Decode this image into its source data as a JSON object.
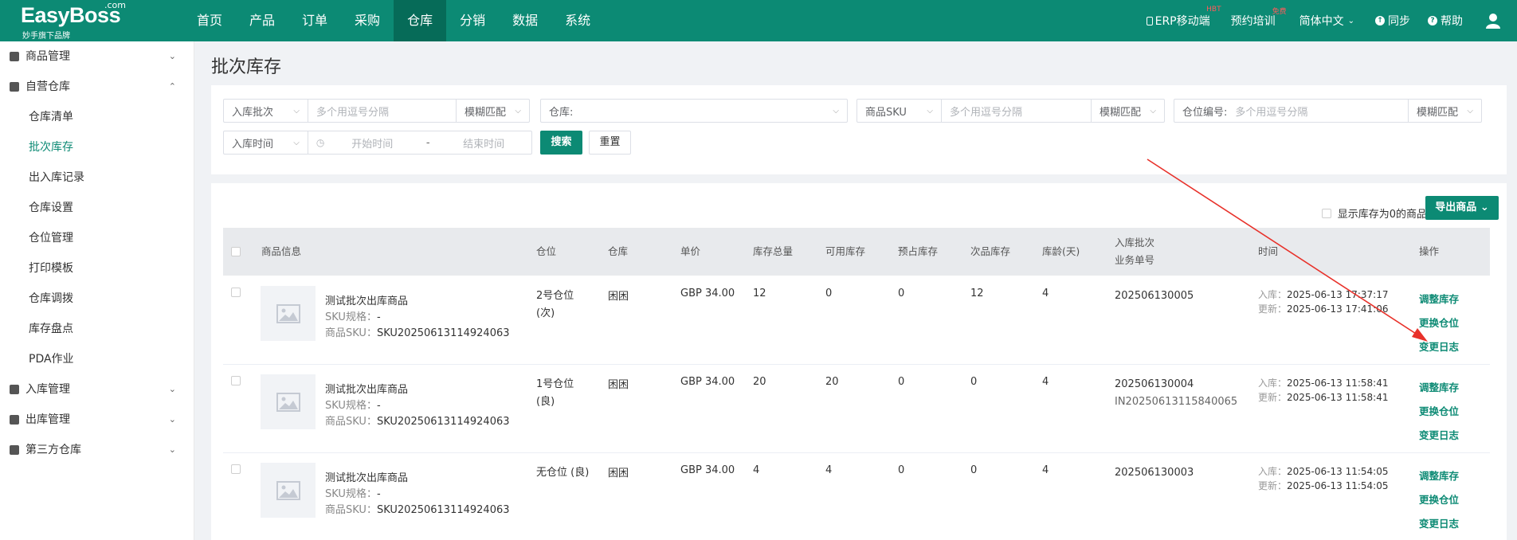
{
  "logo": {
    "brand": "EasyBoss",
    "com": ".com",
    "sub": "妙手旗下品牌"
  },
  "nav": [
    "首页",
    "产品",
    "订单",
    "采购",
    "仓库",
    "分销",
    "数据",
    "系统"
  ],
  "nav_active_index": 4,
  "topright": {
    "erp": "ERP移动端",
    "erp_badge": "HBT",
    "training": "预约培训",
    "training_badge": "免费",
    "lang": "简体中文",
    "sync": "同步",
    "help": "帮助"
  },
  "sidebar": {
    "goods": "商品管理",
    "self_wh": "自营仓库",
    "self_items": [
      "仓库清单",
      "批次库存",
      "出入库记录",
      "仓库设置",
      "仓位管理",
      "打印模板",
      "仓库调拨",
      "库存盘点",
      "PDA作业"
    ],
    "active_sub_index": 1,
    "inbound": "入库管理",
    "outbound": "出库管理",
    "third": "第三方仓库"
  },
  "page_title": "批次库存",
  "filters": {
    "batch_select": "入库批次",
    "batch_ph": "多个用逗号分隔",
    "fuzzy1": "模糊匹配",
    "warehouse_label": "仓库:",
    "sku_select": "商品SKU",
    "sku_ph": "多个用逗号分隔",
    "fuzzy2": "模糊匹配",
    "loc_label": "仓位编号:",
    "loc_ph": "多个用逗号分隔",
    "fuzzy3": "模糊匹配",
    "time_select": "入库时间",
    "start_ph": "开始时间",
    "sep": "-",
    "end_ph": "结束时间",
    "search": "搜索",
    "reset": "重置"
  },
  "toolbar": {
    "show_zero": "显示库存为0的商品",
    "export": "导出商品"
  },
  "table": {
    "headers": {
      "info": "商品信息",
      "loc": "仓位",
      "wh": "仓库",
      "price": "单价",
      "total": "库存总量",
      "avail": "可用库存",
      "reserved": "预占库存",
      "defect": "次品库存",
      "age": "库龄(天)",
      "batch1": "入库批次",
      "batch2": "业务单号",
      "time": "时间",
      "ops": "操作"
    },
    "rows": [
      {
        "name": "测试批次出库商品",
        "spec_label": "SKU规格：",
        "spec": "-",
        "sku_label": "商品SKU：",
        "sku": "SKU20250613114924063",
        "loc1": "2号仓位",
        "loc2": "(次)",
        "wh": "困困",
        "price": "GBP 34.00",
        "total": "12",
        "avail": "0",
        "reserved": "0",
        "defect": "12",
        "age": "4",
        "batch": "202506130005",
        "order": "",
        "in_label": "入库：",
        "in_time": "2025-06-13 17:37:17",
        "up_label": "更新：",
        "up_time": "2025-06-13 17:41:06",
        "op1": "调整库存",
        "op2": "更换仓位",
        "op3": "变更日志"
      },
      {
        "name": "测试批次出库商品",
        "spec_label": "SKU规格：",
        "spec": "-",
        "sku_label": "商品SKU：",
        "sku": "SKU20250613114924063",
        "loc1": "1号仓位",
        "loc2": "(良)",
        "wh": "困困",
        "price": "GBP 34.00",
        "total": "20",
        "avail": "20",
        "reserved": "0",
        "defect": "0",
        "age": "4",
        "batch": "202506130004",
        "order": "IN20250613115840065",
        "in_label": "入库：",
        "in_time": "2025-06-13 11:58:41",
        "up_label": "更新：",
        "up_time": "2025-06-13 11:58:41",
        "op1": "调整库存",
        "op2": "更换仓位",
        "op3": "变更日志"
      },
      {
        "name": "测试批次出库商品",
        "spec_label": "SKU规格：",
        "spec": "-",
        "sku_label": "商品SKU：",
        "sku": "SKU20250613114924063",
        "loc1": "无仓位 (良)",
        "loc2": "",
        "wh": "困困",
        "price": "GBP 34.00",
        "total": "4",
        "avail": "4",
        "reserved": "0",
        "defect": "0",
        "age": "4",
        "batch": "202506130003",
        "order": "",
        "in_label": "入库：",
        "in_time": "2025-06-13 11:54:05",
        "up_label": "更新：",
        "up_time": "2025-06-13 11:54:05",
        "op1": "调整库存",
        "op2": "更换仓位",
        "op3": "变更日志"
      }
    ]
  },
  "colors": {
    "brand": "#0c8a74",
    "arrow": "#e8312a"
  }
}
